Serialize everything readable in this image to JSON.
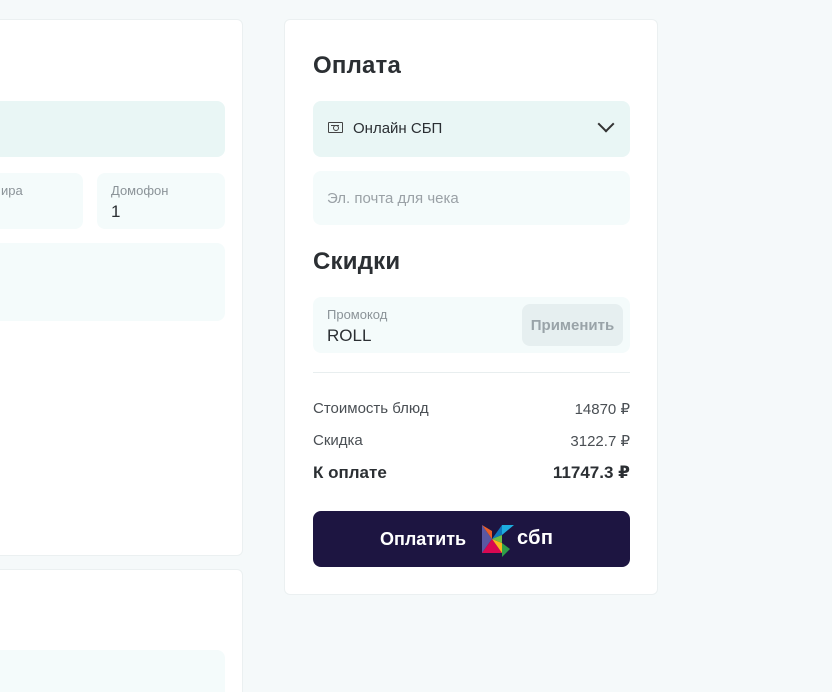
{
  "left": {
    "apartment_label_partial": "ира",
    "intercom_label": "Домофон",
    "intercom_value": "1"
  },
  "payment": {
    "title": "Оплата",
    "method_selected": "Онлайн СБП",
    "email_placeholder": "Эл. почта для чека"
  },
  "discounts": {
    "title": "Скидки",
    "promo_label": "Промокод",
    "promo_value": "ROLL",
    "apply_label": "Применить"
  },
  "summary": {
    "dishes_label": "Стоимость блюд",
    "dishes_value": "14870 ₽",
    "discount_label": "Скидка",
    "discount_value": "3122.7 ₽",
    "total_label": "К оплате",
    "total_value": "11747.3 ₽"
  },
  "pay_button": {
    "label": "Оплатить",
    "brand_text": "сбп"
  },
  "colors": {
    "pay_button_bg": "#1d1541",
    "accent_field_bg": "#e9f6f5"
  }
}
